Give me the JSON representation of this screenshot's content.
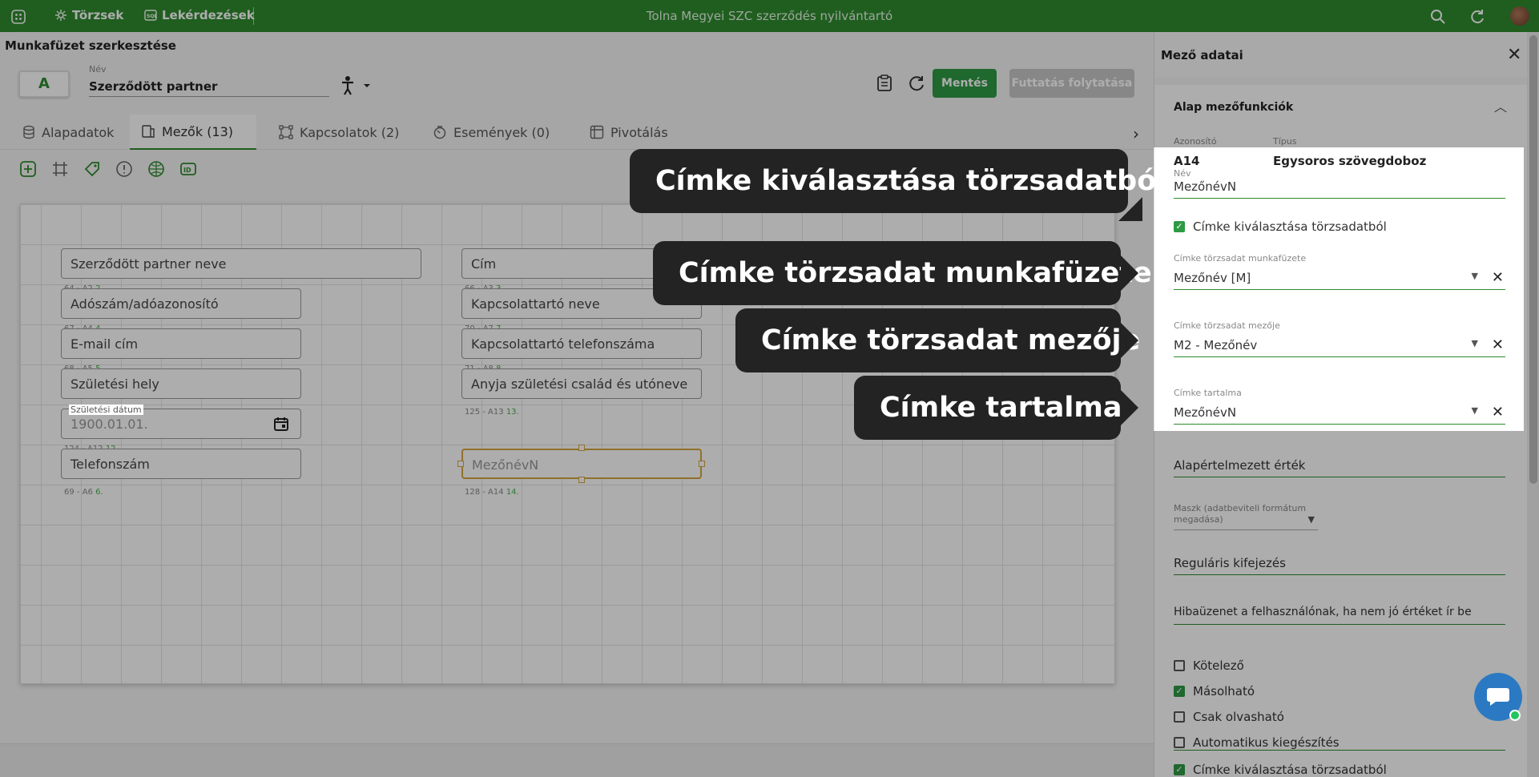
{
  "topbar": {
    "nav1": "Törzsek",
    "nav2": "Lekérdezések",
    "app_title": "Tolna Megyei SZC szerződés nyilvántartó"
  },
  "header": {
    "page_title": "Munkafüzet szerkesztése",
    "workbook_badge": "A",
    "name_label": "Név",
    "name_value": "Szerződött partner",
    "save_label": "Mentés",
    "run_label": "Futtatás folytatása"
  },
  "tabs": [
    {
      "label": "Alapadatok",
      "icon": "database-icon"
    },
    {
      "label": "Mezők (13)",
      "icon": "fields-icon"
    },
    {
      "label": "Kapcsolatok (2)",
      "icon": "relations-icon"
    },
    {
      "label": "Események (0)",
      "icon": "events-icon"
    },
    {
      "label": "Pivotálás",
      "icon": "pivot-icon"
    }
  ],
  "canvas": {
    "fields": [
      {
        "label": "Szerződött partner neve",
        "meta": "",
        "meta_num": ""
      },
      {
        "label": "Adószám/adóazonosító",
        "meta": "64 - A2",
        "meta_num": "2."
      },
      {
        "label": "E-mail cím",
        "meta": "67 - A4",
        "meta_num": "4."
      },
      {
        "label": "Születési hely",
        "meta": "68 - A5",
        "meta_num": "5."
      },
      {
        "label": "1900.01.01.",
        "meta": "Születési dátum",
        "meta_num": ""
      },
      {
        "label": "Telefonszám",
        "meta": "124 - A12",
        "meta_num": "12."
      },
      {
        "label": "Cím",
        "meta": "",
        "meta_num": ""
      },
      {
        "label": "Kapcsolattartó neve",
        "meta": "66 - A3",
        "meta_num": "3."
      },
      {
        "label": "Kapcsolattartó telefonszáma",
        "meta": "70 - A7",
        "meta_num": "7."
      },
      {
        "label": "Anyja születési család és utóneve",
        "meta": "71 - A8",
        "meta_num": "8."
      },
      {
        "label": "MezőnévN",
        "meta": "125 - A13",
        "meta_num": "13."
      }
    ],
    "meta_below_tel": {
      "text": "69 - A6",
      "num": "6."
    },
    "meta_below_new": {
      "text": "128 - A14",
      "num": "14."
    }
  },
  "panel": {
    "title": "Mező adatai",
    "section_title": "Alap mezőfunkciók",
    "id_label": "Azonosító",
    "type_label": "Típus",
    "id_value": "A14",
    "type_value": "Egysoros szövegdoboz",
    "name_label": "Név",
    "name_value": "MezőnévN",
    "chk_label_from_master": "Címke kiválasztása törzsadatból",
    "master_workbook_label": "Címke törzsadat munkafüzete",
    "master_workbook_value": "Mezőnév [M]",
    "master_field_label": "Címke törzsadat mezője",
    "master_field_value": "M2 - Mezőnév",
    "label_content_label": "Címke tartalma",
    "label_content_value": "MezőnévN",
    "default_value_placeholder": "Alapértelmezett érték",
    "mask_placeholder": "Maszk (adatbeviteli formátum megadása)",
    "regex_placeholder": "Reguláris kifejezés",
    "error_msg_placeholder": "Hibaüzenet a felhasználónak, ha nem jó értéket ír be",
    "checkboxes": [
      {
        "label": "Kötelező",
        "checked": false
      },
      {
        "label": "Másolható",
        "checked": true
      },
      {
        "label": "Csak olvasható",
        "checked": false
      },
      {
        "label": "Automatikus kiegészítés",
        "checked": false
      },
      {
        "label": "Címke kiválasztása törzsadatból",
        "checked": true
      }
    ]
  },
  "callouts": {
    "c1": "Címke kiválasztása törzsadatból",
    "c2": "Címke törzsadat munkafüzete",
    "c3": "Címke törzsadat mezője",
    "c4": "Címke tartalma"
  },
  "colors": {
    "brand": "#2e8b2e",
    "save": "#2e9a44",
    "callout": "#232323"
  }
}
